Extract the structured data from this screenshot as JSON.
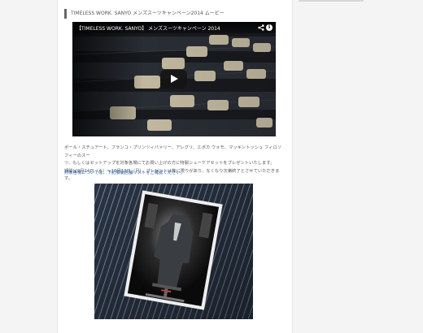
{
  "article": {
    "heading": "TIMELESS WORK. SANYO メンズスーツキャンペーン2014 ムービー",
    "video": {
      "title": "【TIMELESS WORK. SANYO】 メンズスーツキャンペーン 2014",
      "share_icon": "share-icon",
      "info_icon": "info-icon",
      "info_glyph": "i",
      "play_icon": "play-icon"
    },
    "paragraph_lines": [
      "ポール・スチュアート、フランコ・プリンツィバァリー、アレグリ、エポカ ウォモ、マッキントッシュ フィロソフィーのスー",
      "ツ、もしくはセットアップを対象各場にてお買い上げの方に特製シューケアセットをプレゼントいたします。",
      "期間は9月24日（水）〜10月13日（月）。プレゼントは数に限りがあり、なくなり次第終了とさせていただきます。"
    ],
    "store_link": "対象各場については、下記展開店舗リストをご確認ください。"
  },
  "colors": {
    "link": "#2a5ea8",
    "text": "#555555",
    "heading_bar": "#666666"
  }
}
